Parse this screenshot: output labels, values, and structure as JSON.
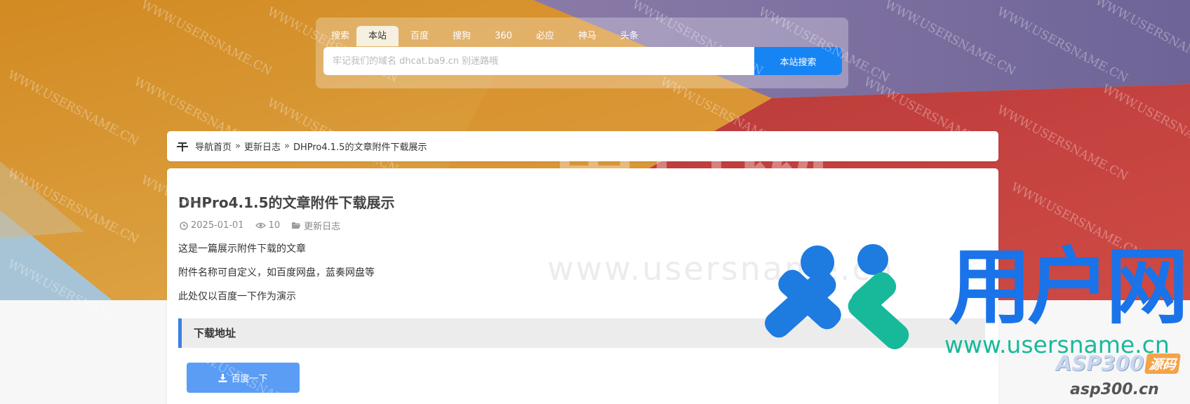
{
  "search": {
    "engines": [
      "搜索",
      "本站",
      "百度",
      "搜狗",
      "360",
      "必应",
      "神马",
      "头条"
    ],
    "active_engine": "本站",
    "placeholder": "牢记我们的域名 dhcat.ba9.cn 别迷路哦",
    "button_label": "本站搜索"
  },
  "breadcrumb": {
    "home": "导航首页",
    "separator": "»",
    "category": "更新日志",
    "current": "DHPro4.1.5的文章附件下载展示"
  },
  "article": {
    "title": "DHPro4.1.5的文章附件下载展示",
    "date": "2025-01-01",
    "views": "10",
    "category": "更新日志",
    "paragraphs": [
      "这是一篇展示附件下载的文章",
      "附件名称可自定义，如百度网盘，蓝奏网盘等",
      "此处仅以百度一下作为演示"
    ],
    "download_heading": "下载地址",
    "download_button": "百度一下"
  },
  "watermark": {
    "tile_text": "WWW.USERSNAME.CN",
    "logo_text": "用户网",
    "logo_url": "www.usersname.cn",
    "brand": "ASP300",
    "brand_badge": "源码",
    "brand_url": "asp300.cn",
    "ghost_text": "用户网",
    "ghost_url": "www.usersname.cn"
  },
  "colors": {
    "accent": "#1784f4",
    "download_button": "#5b9df5",
    "heading_bar": "#3d7fe6",
    "logo_blue": "#1a73e8",
    "logo_teal": "#18b99a"
  }
}
